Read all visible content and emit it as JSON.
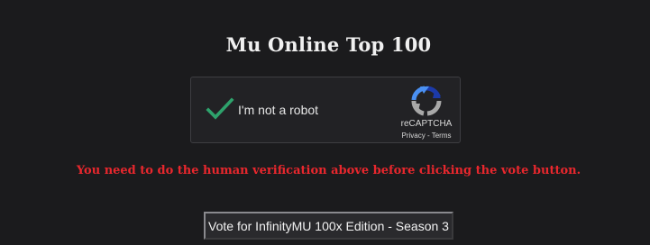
{
  "page": {
    "title": "Mu Online Top 100"
  },
  "captcha": {
    "label": "I'm not a robot",
    "brand": "reCAPTCHA",
    "privacy_link": "Privacy",
    "separator": " - ",
    "terms_link": "Terms",
    "checked": true,
    "check_color": "#2ea26c",
    "icon": "check-icon"
  },
  "warning": {
    "text": "You need to do the human verification above before clicking the vote button.",
    "color": "#e8272d"
  },
  "vote": {
    "button_label": "Vote for InfinityMU 100x Edition - Season 3"
  }
}
